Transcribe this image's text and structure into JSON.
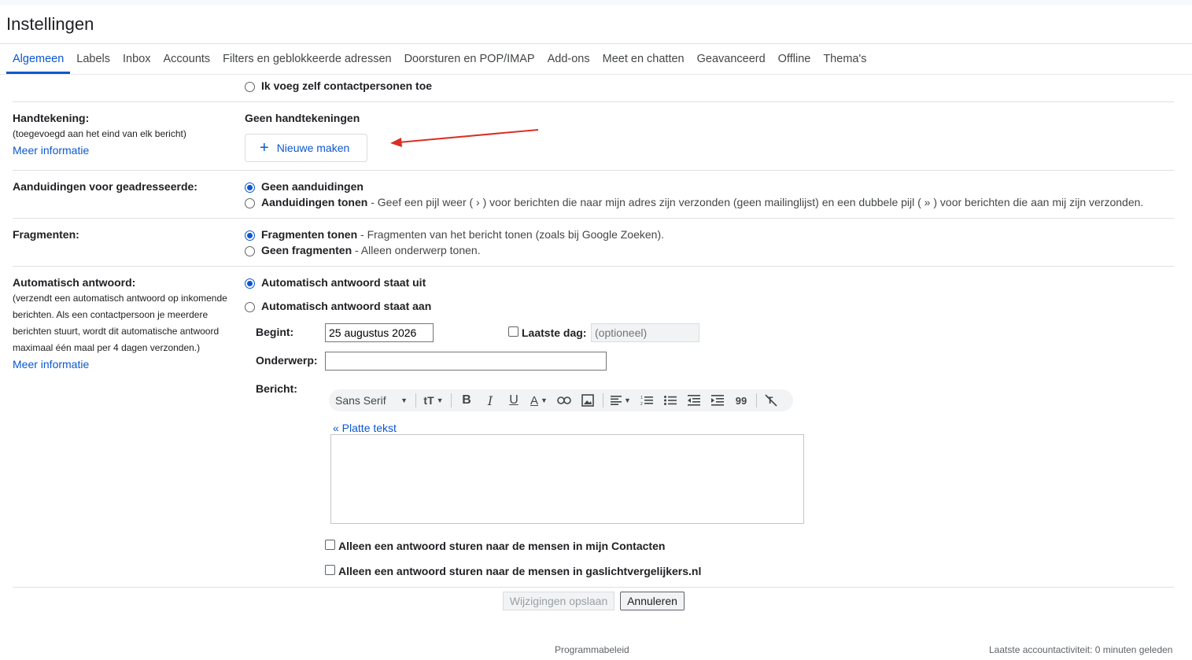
{
  "title": "Instellingen",
  "tabs": [
    {
      "label": "Algemeen",
      "active": true
    },
    {
      "label": "Labels"
    },
    {
      "label": "Inbox"
    },
    {
      "label": "Accounts"
    },
    {
      "label": "Filters en geblokkeerde adressen"
    },
    {
      "label": "Doorsturen en POP/IMAP"
    },
    {
      "label": "Add-ons"
    },
    {
      "label": "Meet en chatten"
    },
    {
      "label": "Geavanceerd"
    },
    {
      "label": "Offline"
    },
    {
      "label": "Thema's"
    }
  ],
  "contacts": {
    "option_manual": "Ik voeg zelf contactpersonen toe"
  },
  "signature": {
    "label": "Handtekening:",
    "note": "(toegevoegd aan het eind van elk bericht)",
    "more_info": "Meer informatie",
    "status": "Geen handtekeningen",
    "new_button": "Nieuwe maken"
  },
  "indicators": {
    "label": "Aanduidingen voor geadresseerde:",
    "opt1": "Geen aanduidingen",
    "opt2": "Aanduidingen tonen",
    "opt2_desc": " - Geef een pijl weer ( › ) voor berichten die naar mijn adres zijn verzonden (geen mailinglijst) en een dubbele pijl ( » ) voor berichten die aan mij zijn verzonden."
  },
  "snippets": {
    "label": "Fragmenten:",
    "opt1": "Fragmenten tonen",
    "opt1_desc": " - Fragmenten van het bericht tonen (zoals bij Google Zoeken).",
    "opt2": "Geen fragmenten",
    "opt2_desc": " - Alleen onderwerp tonen."
  },
  "autoreply": {
    "label": "Automatisch antwoord:",
    "note_lines": [
      "(verzendt een automatisch antwoord op inkomende",
      "berichten. Als een contactpersoon je meerdere",
      "berichten stuurt, wordt dit automatische antwoord",
      "maximaal één maal per 4 dagen verzonden.)"
    ],
    "more_info": "Meer informatie",
    "opt_off": "Automatisch antwoord staat uit",
    "opt_on": "Automatisch antwoord staat aan",
    "start_label": "Begint:",
    "start_value": "25 augustus 2026",
    "last_day_label": "Laatste dag:",
    "last_day_placeholder": "(optioneel)",
    "subject_label": "Onderwerp:",
    "subject_value": "",
    "message_label": "Bericht:",
    "font": "Sans Serif",
    "plain_text_link": "« Platte tekst",
    "contacts_only": "Alleen een antwoord sturen naar de mensen in mijn Contacten",
    "domain_only": "Alleen een antwoord sturen naar de mensen in gaslichtvergelijkers.nl"
  },
  "actions": {
    "save": "Wijzigingen opslaan",
    "cancel": "Annuleren"
  },
  "footer": {
    "policy": "Programmabeleid",
    "activity": "Laatste accountactiviteit: 0 minuten geleden"
  },
  "colors": {
    "accent": "#0b57d0",
    "arrow": "#d93025"
  }
}
